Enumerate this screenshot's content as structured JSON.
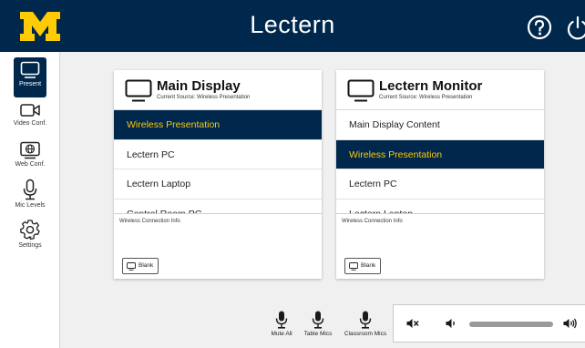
{
  "header": {
    "title": "Lectern"
  },
  "sidebar": {
    "items": [
      {
        "label": "Present",
        "icon": "monitor-icon",
        "active": true
      },
      {
        "label": "Video Conf.",
        "icon": "video-camera-icon"
      },
      {
        "label": "Web Conf.",
        "icon": "globe-monitor-icon"
      },
      {
        "label": "Mic Levels",
        "icon": "microphone-icon"
      },
      {
        "label": "Settings",
        "icon": "gear-icon"
      }
    ]
  },
  "panels": [
    {
      "title": "Main Display",
      "subtitle": "Current Source: Wireless Presentation",
      "sources": [
        "Wireless Presentation",
        "Lectern PC",
        "Lectern Laptop",
        "Control Room PC"
      ],
      "active_source": "Wireless Presentation",
      "info_label": "Wireless Connection Info",
      "blank_label": "Blank"
    },
    {
      "title": "Lectern Monitor",
      "subtitle": "Current Source: Wireless Presentation",
      "sources": [
        "Main Display Content",
        "Wireless Presentation",
        "Lectern PC",
        "Lectern Laptop"
      ],
      "active_source": "Wireless Presentation",
      "info_label": "Wireless Connection Info",
      "blank_label": "Blank"
    }
  ],
  "mics": {
    "mute_all": "Mute All",
    "table_mics": "Table Mics",
    "classroom_mics": "Classroom Mics"
  },
  "volume": {
    "icons": [
      "mute-icon",
      "volume-down-icon",
      "volume-up-icon"
    ]
  },
  "colors": {
    "navy": "#00274c",
    "maize": "#ffcb05",
    "background": "#f0f0f0"
  }
}
